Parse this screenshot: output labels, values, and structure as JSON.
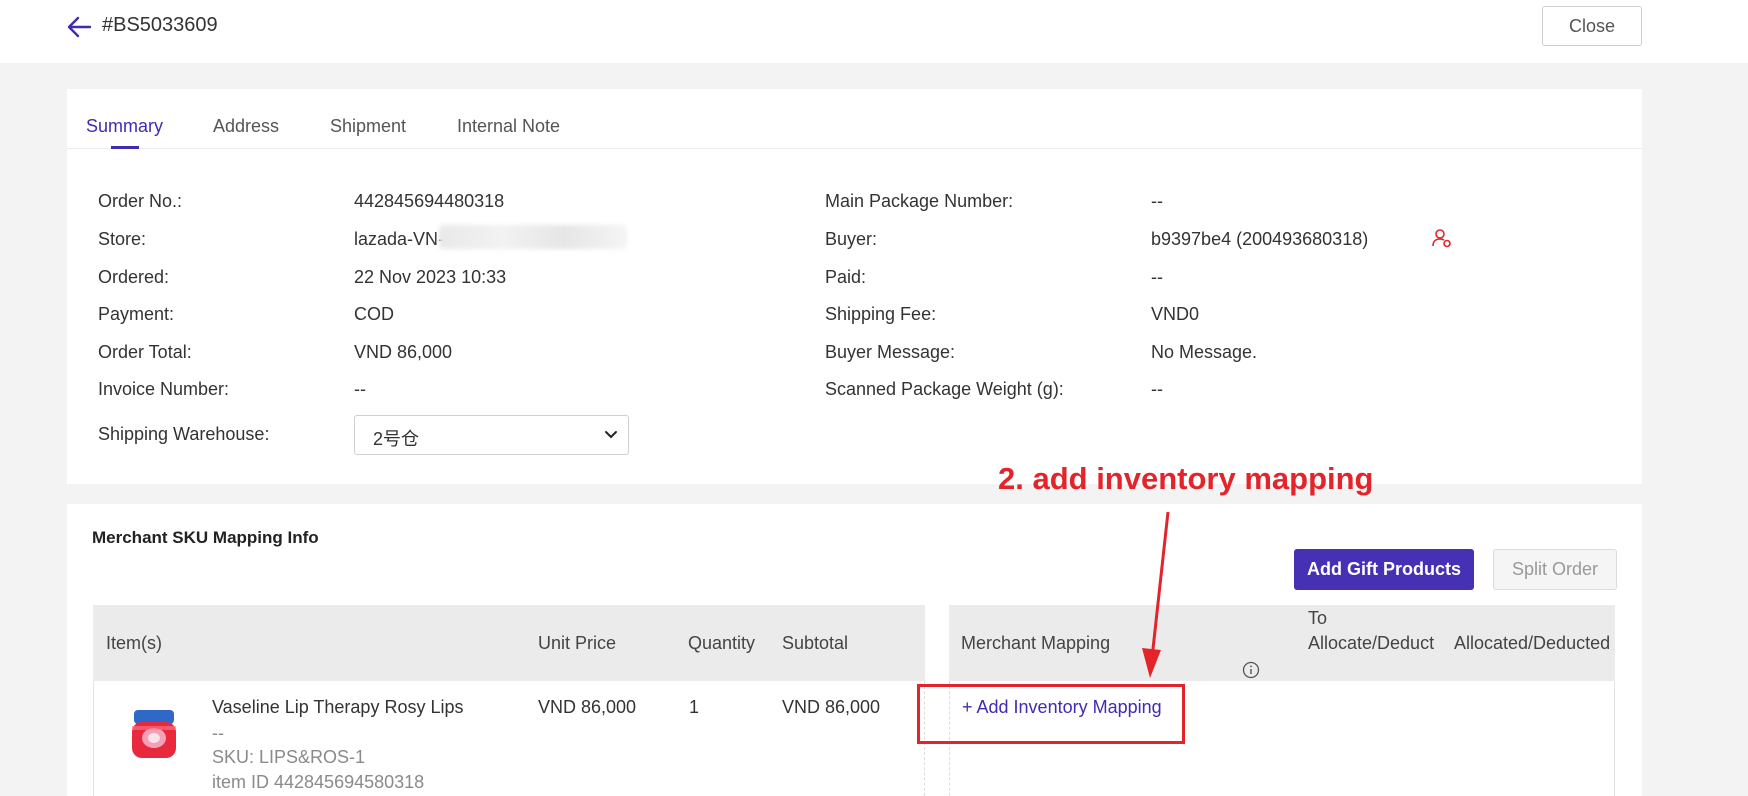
{
  "header": {
    "order_number": "#BS5033609",
    "close_label": "Close"
  },
  "tabs": [
    {
      "label": "Summary",
      "active": true
    },
    {
      "label": "Address",
      "active": false
    },
    {
      "label": "Shipment",
      "active": false
    },
    {
      "label": "Internal Note",
      "active": false
    }
  ],
  "summary": {
    "order_no_label": "Order No.:",
    "order_no": "442845694480318",
    "store_label": "Store:",
    "store": "lazada-VN-",
    "ordered_label": "Ordered:",
    "ordered": "22 Nov 2023 10:33",
    "payment_label": "Payment:",
    "payment": "COD",
    "order_total_label": "Order Total:",
    "order_total": "VND 86,000",
    "invoice_label": "Invoice Number:",
    "invoice": "--",
    "warehouse_label": "Shipping Warehouse:",
    "warehouse": "2号仓",
    "main_package_label": "Main Package Number:",
    "main_package": "--",
    "buyer_label": "Buyer:",
    "buyer": "b9397be4 (200493680318)",
    "paid_label": "Paid:",
    "paid": "--",
    "shipping_fee_label": "Shipping Fee:",
    "shipping_fee": "VND0",
    "buyer_message_label": "Buyer Message:",
    "buyer_message": "No Message.",
    "package_weight_label": "Scanned Package Weight (g):",
    "package_weight": "--"
  },
  "mapping": {
    "title": "Merchant SKU Mapping Info",
    "add_gift_label": "Add Gift Products",
    "split_order_label": "Split Order",
    "columns": {
      "items": "Item(s)",
      "unit_price": "Unit Price",
      "quantity": "Quantity",
      "subtotal": "Subtotal",
      "merchant_mapping": "Merchant Mapping",
      "to_allocate_1": "To",
      "to_allocate_2": "Allocate/Deduct",
      "allocated": "Allocated/Deducted"
    },
    "rows": [
      {
        "name": "Vaseline Lip Therapy Rosy Lips",
        "variant": "--",
        "sku": "SKU: LIPS&ROS-1",
        "item_id": "item ID 442845694580318",
        "unit_price": "VND 86,000",
        "quantity": "1",
        "subtotal": "VND 86,000",
        "mapping_action": "+ Add Inventory Mapping"
      }
    ]
  },
  "annotation": {
    "text": "2. add inventory mapping",
    "color": "#e3242b"
  },
  "colors": {
    "accent": "#3f2cb0",
    "primary_button": "#4631b5"
  }
}
